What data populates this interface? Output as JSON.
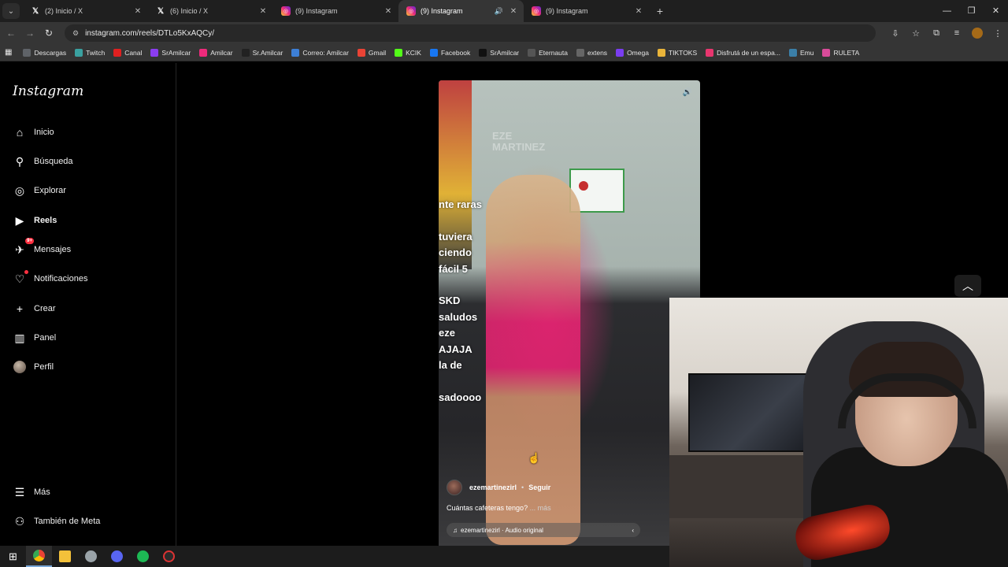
{
  "browser": {
    "tabs": [
      {
        "title": "(2) Inicio / X",
        "icon": "x-logo-icon",
        "active": false
      },
      {
        "title": "(6) Inicio / X",
        "icon": "x-logo-icon",
        "active": false
      },
      {
        "title": "(9) Instagram",
        "icon": "instagram-icon",
        "active": false
      },
      {
        "title": "(9) Instagram",
        "icon": "instagram-icon",
        "active": true
      },
      {
        "title": "(9) Instagram",
        "icon": "instagram-icon",
        "active": false
      }
    ],
    "url": "instagram.com/reels/DTLo5KxAQCy/",
    "bookmarks": [
      {
        "label": "Descargas",
        "color": "#5f6368"
      },
      {
        "label": "Twitch",
        "color": "#3aa1a0"
      },
      {
        "label": "Canal",
        "color": "#e02020"
      },
      {
        "label": "SrAmilcar",
        "color": "#8b3df0"
      },
      {
        "label": "Amilcar",
        "color": "#ee2a7b"
      },
      {
        "label": "Sr.Amilcar",
        "color": "#222222"
      },
      {
        "label": "Correo: Amilcar",
        "color": "#3d7fd6"
      },
      {
        "label": "Gmail",
        "color": "#ea4335"
      },
      {
        "label": "KCIK",
        "color": "#53fc18"
      },
      {
        "label": "Facebook",
        "color": "#1877f2"
      },
      {
        "label": "SrAmilcar",
        "color": "#111111"
      },
      {
        "label": "Eternauta",
        "color": "#555555"
      },
      {
        "label": "extens",
        "color": "#666666"
      },
      {
        "label": "Omega",
        "color": "#7a3df0"
      },
      {
        "label": "TIKTOKS",
        "color": "#e9b43a"
      },
      {
        "label": "Disfrutá de un espa...",
        "color": "#e8366f"
      },
      {
        "label": "Emu",
        "color": "#3b7fa8"
      },
      {
        "label": "RULETA",
        "color": "#d94b9a"
      }
    ]
  },
  "instagram": {
    "logo": "Instagram",
    "nav": [
      {
        "label": "Inicio",
        "icon": "home-icon",
        "glyph": "⌂"
      },
      {
        "label": "Búsqueda",
        "icon": "search-icon",
        "glyph": "⚲"
      },
      {
        "label": "Explorar",
        "icon": "compass-icon",
        "glyph": "◎"
      },
      {
        "label": "Reels",
        "icon": "reels-icon",
        "glyph": "▶"
      },
      {
        "label": "Mensajes",
        "icon": "messenger-icon",
        "glyph": "✈",
        "badge": "9+"
      },
      {
        "label": "Notificaciones",
        "icon": "heart-icon",
        "glyph": "♡"
      },
      {
        "label": "Crear",
        "icon": "plus-icon",
        "glyph": "+"
      },
      {
        "label": "Panel",
        "icon": "dashboard-icon",
        "glyph": "▥"
      },
      {
        "label": "Perfil",
        "icon": "profile-avatar",
        "glyph": ""
      }
    ],
    "more": "Más",
    "meta": "También de Meta",
    "reel": {
      "watermark_line1": "EZE",
      "watermark_line2": "MARTINEZ",
      "overlay_lines": [
        "nte raras",
        "",
        "tuviera",
        "ciendo",
        "fácil 5",
        "",
        "SKD",
        "saludos",
        "eze",
        "AJAJA",
        "la de",
        "",
        "sadoooo"
      ],
      "username": "ezemartinezirl",
      "separator": "•",
      "follow": "Seguir",
      "caption": "Cuántas cafeteras tengo?",
      "caption_more": "... más",
      "audio": "ezemartinezirl · Audio original"
    }
  }
}
